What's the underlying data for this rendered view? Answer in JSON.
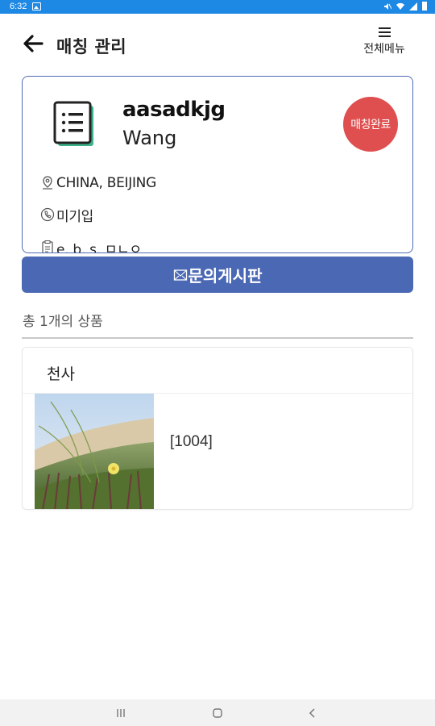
{
  "status_bar": {
    "time": "6:32",
    "bg_color": "#1e88e5"
  },
  "header": {
    "title": "매칭 관리",
    "menu_label": "전체메뉴"
  },
  "card": {
    "name": "aasadkjg",
    "subname": "Wang",
    "badge": "매칭완료",
    "badge_color": "#df4f4f",
    "location": "CHINA, BEIJING",
    "phone": "미기입",
    "tags": "e, b, s, ㅁㄴㅇ"
  },
  "inquiry_button": {
    "label": "문의게시판",
    "color": "#4b68b4"
  },
  "products": {
    "count_label": "총 1개의 상품",
    "items": [
      {
        "category": "천사",
        "code": "[1004]"
      }
    ]
  },
  "icons": [
    "back-arrow-icon",
    "menu-icon",
    "document-icon",
    "location-pin-icon",
    "phone-icon",
    "clipboard-icon",
    "envelope-icon",
    "recent-apps-icon",
    "home-icon",
    "back-nav-icon"
  ]
}
